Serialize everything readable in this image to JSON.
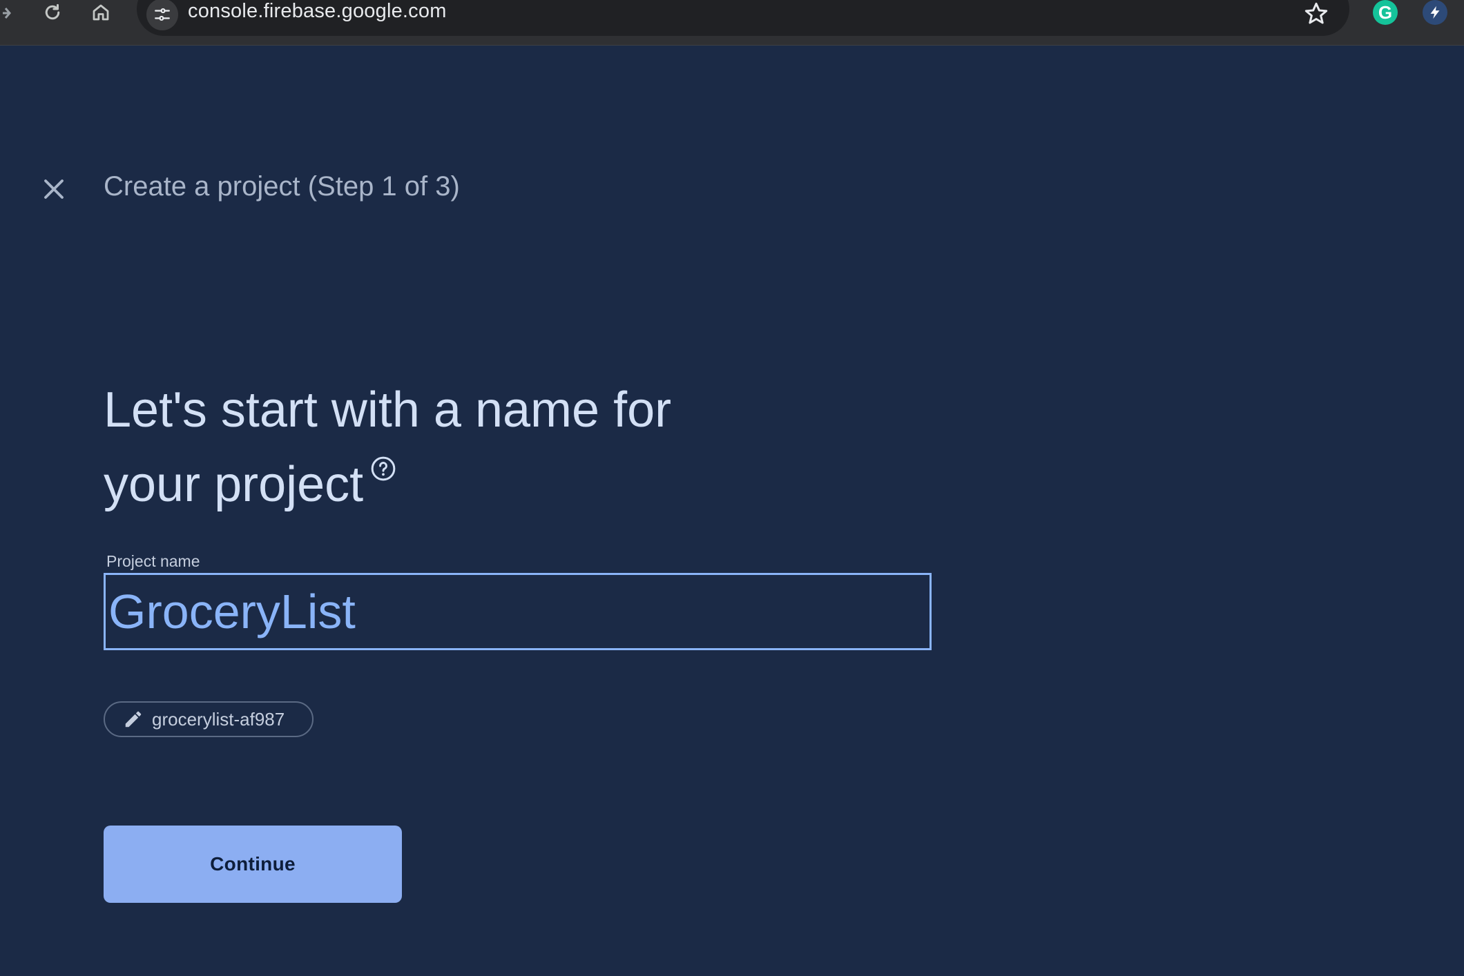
{
  "browser": {
    "url": "console.firebase.google.com",
    "icons": [
      "forward-arrow-icon",
      "reload-icon",
      "home-icon",
      "site-info-icon",
      "star-icon",
      "grammarly-extension-icon",
      "bolt-extension-icon"
    ],
    "grammarly_letter": "G"
  },
  "dialog": {
    "step_title": "Create a project (Step 1 of 3)",
    "heading_line1": "Let's start with a name for",
    "heading_line2": "your project",
    "field_label": "Project name",
    "project_name_value": "GroceryList",
    "project_id": "grocerylist-af987",
    "continue_label": "Continue"
  },
  "colors": {
    "page_background": "#1b2a46",
    "accent": "#8ab4f8",
    "button_fill": "#8caef2"
  }
}
